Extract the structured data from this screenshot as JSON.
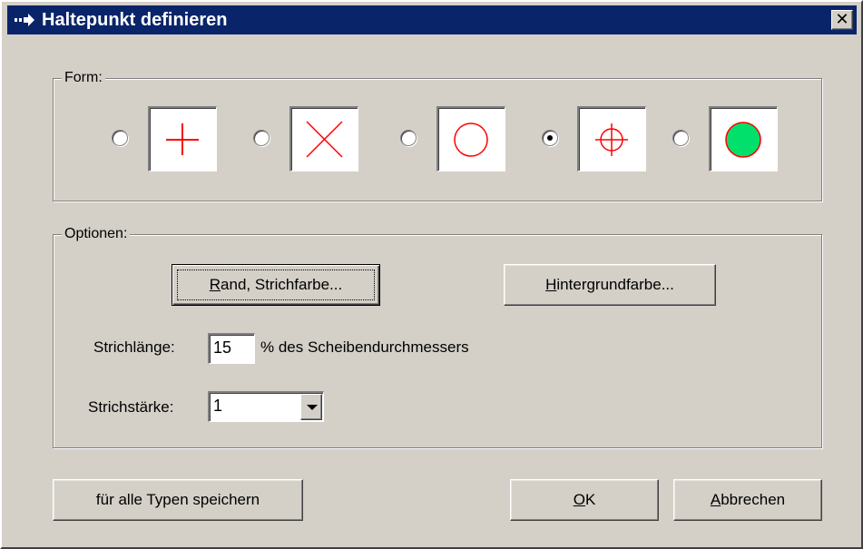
{
  "window": {
    "title": "Haltepunkt definieren",
    "close_glyph": "✕"
  },
  "form_group": {
    "legend": "Form:",
    "options": [
      {
        "icon": "cross-plus-icon",
        "selected": false
      },
      {
        "icon": "cross-x-icon",
        "selected": false
      },
      {
        "icon": "circle-outline-icon",
        "selected": false
      },
      {
        "icon": "crosshair-circle-icon",
        "selected": true
      },
      {
        "icon": "filled-green-circle-icon",
        "selected": false
      }
    ],
    "colors": {
      "stroke": "#ff0000",
      "fill": "#00e06a"
    }
  },
  "options_group": {
    "legend": "Optionen:",
    "border_color_button": {
      "mnemonic": "R",
      "rest": "and, Strichfarbe..."
    },
    "background_color_button": {
      "mnemonic": "H",
      "rest": "intergrundfarbe..."
    },
    "stroke_length_label": "Strichlänge:",
    "stroke_length_value": "15",
    "stroke_length_unit": "% des Scheibendurchmessers",
    "stroke_width_label": "Strichstärke:",
    "stroke_width_value": "1"
  },
  "footer": {
    "save_all_button": "für alle Typen speichern",
    "ok_button": {
      "mnemonic": "O",
      "rest": "K"
    },
    "cancel_button": {
      "mnemonic": "A",
      "rest": "bbrechen"
    }
  }
}
